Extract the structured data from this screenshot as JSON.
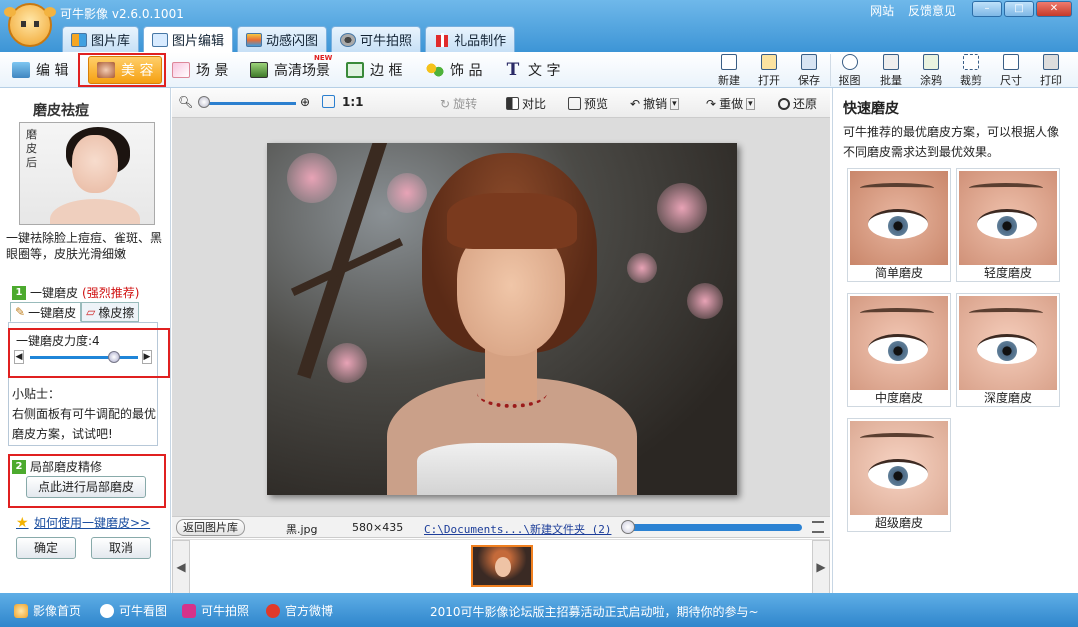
{
  "app": {
    "title": "可牛影像",
    "version": "v2.6.0.1001",
    "links": [
      "网站",
      "反馈意见"
    ],
    "window_buttons": [
      "–",
      "□",
      "✕"
    ]
  },
  "main_tabs": [
    {
      "label": "图片库",
      "icon": "library-icon",
      "active": false
    },
    {
      "label": "图片编辑",
      "icon": "edit-icon",
      "active": true
    },
    {
      "label": "动感闪图",
      "icon": "flash-icon",
      "active": false
    },
    {
      "label": "可牛拍照",
      "icon": "camera-icon",
      "active": false
    },
    {
      "label": "礼品制作",
      "icon": "gift-icon",
      "active": false
    }
  ],
  "sub_tabs": [
    {
      "label": "编 辑",
      "icon": "edit-photo-icon"
    },
    {
      "label": "美 容",
      "icon": "beauty-icon",
      "active": true
    },
    {
      "label": "场 景",
      "icon": "scene-icon"
    },
    {
      "label": "高清场景",
      "icon": "hd-scene-icon",
      "badge": "NEW"
    },
    {
      "label": "边 框",
      "icon": "frame-icon"
    },
    {
      "label": "饰 品",
      "icon": "accessory-icon"
    },
    {
      "label": "文 字",
      "icon": "text-icon"
    }
  ],
  "tools": [
    "新建",
    "打开",
    "保存",
    "抠图",
    "批量",
    "涂鸦",
    "裁剪",
    "尺寸",
    "打印"
  ],
  "left": {
    "title": "磨皮祛痘",
    "preview_label": "磨皮后",
    "description": "一键祛除脸上痘痘、雀斑、黑眼圈等，皮肤光滑细嫩",
    "step1_num": "1",
    "step1_label": "一键磨皮",
    "step1_note": "(强烈推荐)",
    "tab_one_click": "一键磨皮",
    "tab_eraser": "橡皮擦",
    "strength_label": "一键磨皮力度:",
    "strength_value": "4",
    "strength_fraction": 0.78,
    "tip_title": "小贴士：",
    "tip_text": "右侧面板有可牛调配的最优磨皮方案，试试吧!",
    "step2_num": "2",
    "step2_label": "局部磨皮精修",
    "local_button": "点此进行局部磨皮",
    "howto_link": "如何使用一键磨皮>>",
    "ok": "确定",
    "cancel": "取消"
  },
  "canvas_toolbar": {
    "zoom_ratio": "1:1",
    "rotate": "旋转",
    "compare": "对比",
    "preview": "预览",
    "undo": "撤销",
    "redo": "重做",
    "restore": "还原"
  },
  "status": {
    "back_button": "返回图片库",
    "filename": "黑.jpg",
    "dimensions": "580×435",
    "path": "C:\\Documents...\\新建文件夹 (2)"
  },
  "right": {
    "title": "快速磨皮",
    "description": "可牛推荐的最优磨皮方案，可以根据人像不同磨皮需求达到最优效果。",
    "presets": [
      "简单磨皮",
      "轻度磨皮",
      "中度磨皮",
      "深度磨皮",
      "超级磨皮"
    ]
  },
  "bottom": {
    "links": [
      "影像首页",
      "可牛看图",
      "可牛拍照",
      "官方微博"
    ],
    "news": "2010可牛影像论坛版主招募活动正式启动啦，期待你的参与~"
  }
}
